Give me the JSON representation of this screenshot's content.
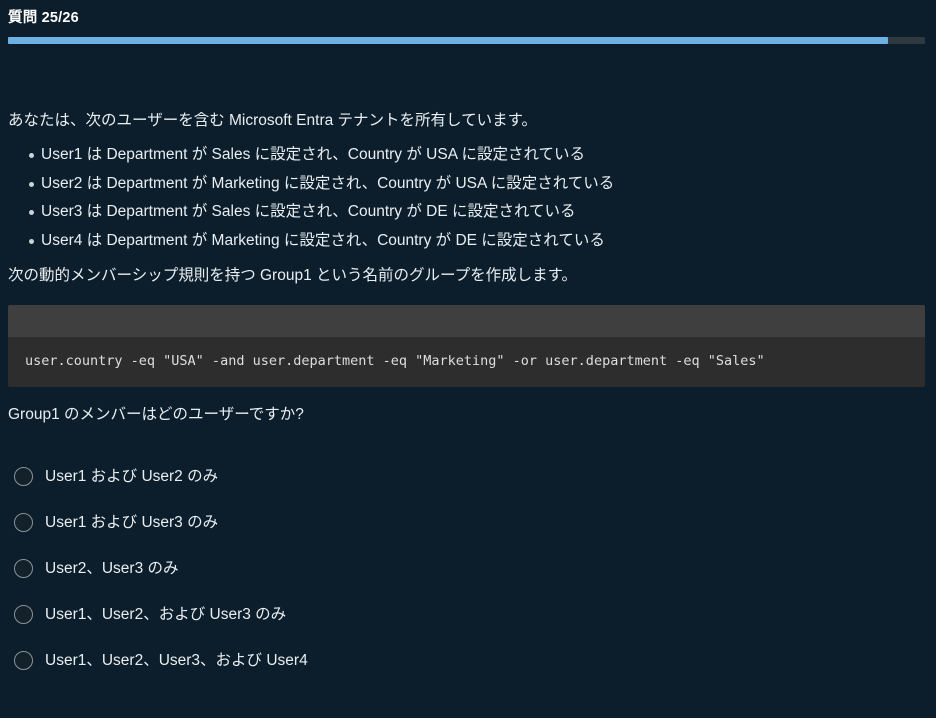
{
  "header": {
    "counter_label": "質問 25/26",
    "progress_percent": 96,
    "progress_fill_color": "#6cb0e4",
    "progress_track_color": "#2e3a40"
  },
  "question": {
    "stem": "あなたは、次のユーザーを含む Microsoft Entra テナントを所有しています。",
    "facts": [
      "User1 は Department が Sales に設定され、Country が USA に設定されている",
      "User2 は Department が Marketing に設定され、Country が USA に設定されている",
      "User3 は Department が Sales に設定され、Country が DE に設定されている",
      "User4 は Department が Marketing に設定され、Country が DE に設定されている"
    ],
    "stem_2": "次の動的メンバーシップ規則を持つ Group1 という名前のグループを作成します。",
    "code": "user.country -eq \"USA\" -and user.department -eq \"Marketing\" -or user.department -eq \"Sales\"",
    "prompt": "Group1 のメンバーはどのユーザーですか?"
  },
  "options": [
    {
      "label": "User1 および User2 のみ",
      "selected": false
    },
    {
      "label": "User1 および User3 のみ",
      "selected": false
    },
    {
      "label": "User2、User3 のみ",
      "selected": false
    },
    {
      "label": "User1、User2、および User3 のみ",
      "selected": false
    },
    {
      "label": "User1、User2、User3、および User4",
      "selected": false
    }
  ],
  "theme": {
    "background": "#0c1e2b",
    "text": "#e9eef2",
    "code_header_bg": "#3f3f3f",
    "code_body_bg": "#2d2d2d",
    "code_text": "#dedede",
    "radio_border": "#8c9296"
  }
}
